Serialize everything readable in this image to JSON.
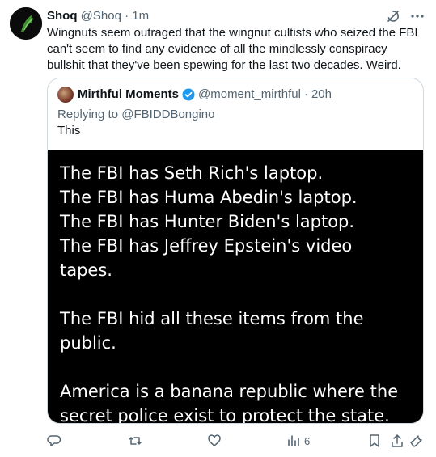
{
  "tweet": {
    "author_name": "Shoq",
    "handle": "@Shoq",
    "separator": "·",
    "time": "1m",
    "text": "Wingnuts seem outraged that the wingnut cultists who seized the FBI can't seem to find any evidence of all the mindlessly conspiracy bullshit that they've been spewing for the last two decades.  Weird."
  },
  "quote": {
    "author_name": "Mirthful Moments",
    "handle": "@moment_mirthful",
    "separator": "·",
    "time": "20h",
    "replying_to": "Replying to @FBIDDBongino",
    "text": "This",
    "image_text": "The FBI has Seth Rich's laptop.\nThe FBI has Huma Abedin's laptop.\nThe FBI has Hunter Biden's laptop.\nThe FBI has Jeffrey Epstein's video\ntapes.\n\nThe FBI hid all these items from the\npublic.\n\nAmerica is a banana republic where the\nsecret police exist to protect the state."
  },
  "actions": {
    "views_count": "6"
  },
  "icons": [
    "grok-icon",
    "more-icon",
    "verified-icon",
    "reply-icon",
    "retweet-icon",
    "like-icon",
    "views-icon",
    "bookmark-icon",
    "share-icon",
    "promote-icon"
  ],
  "colors": {
    "accent": "#1d9bf0",
    "muted": "#536471",
    "border": "#cfd9de",
    "text": "#0f1419"
  }
}
